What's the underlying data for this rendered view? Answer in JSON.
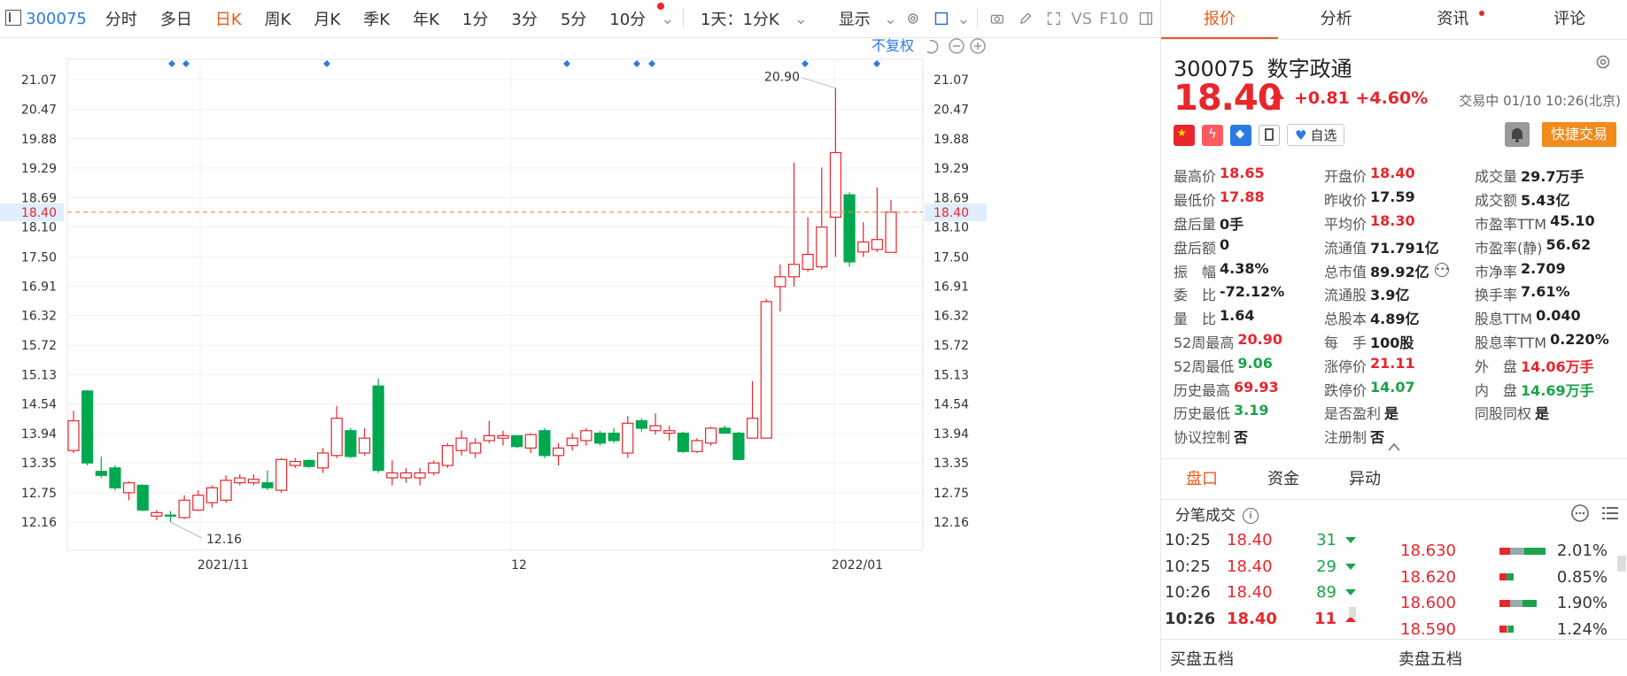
{
  "toolbar": {
    "code": "300075",
    "items": [
      "分时",
      "多日",
      "日K",
      "周K",
      "月K",
      "季K",
      "年K",
      "1分",
      "3分",
      "5分",
      "10分"
    ],
    "active": "日K",
    "timeframe": "1天：1分K",
    "display": "显示",
    "vs": "VS",
    "f10": "F10"
  },
  "chart_data": {
    "type": "candlestick",
    "y_ticks": [
      "21.07",
      "20.47",
      "19.88",
      "19.29",
      "18.69",
      "18.10",
      "17.50",
      "16.91",
      "16.32",
      "15.72",
      "15.13",
      "14.54",
      "13.94",
      "13.35",
      "12.75",
      "12.16"
    ],
    "current_price_label": "18.40",
    "current_price": 18.4,
    "x_labels": [
      "2021/11",
      "12",
      "2022/01"
    ],
    "max_label": "20.90",
    "min_label": "12.16",
    "adjust_label": "不复权",
    "up_color": "#e8262c",
    "down_color": "#00a84f",
    "candles": [
      {
        "o": 13.6,
        "h": 14.4,
        "l": 13.55,
        "c": 14.2
      },
      {
        "o": 14.8,
        "h": 14.82,
        "l": 13.3,
        "c": 13.35
      },
      {
        "o": 13.18,
        "h": 13.48,
        "l": 13.05,
        "c": 13.1
      },
      {
        "o": 13.25,
        "h": 13.3,
        "l": 12.8,
        "c": 12.85
      },
      {
        "o": 12.75,
        "h": 12.98,
        "l": 12.6,
        "c": 12.95
      },
      {
        "o": 12.9,
        "h": 12.92,
        "l": 12.38,
        "c": 12.4
      },
      {
        "o": 12.28,
        "h": 12.4,
        "l": 12.2,
        "c": 12.35
      },
      {
        "o": 12.3,
        "h": 12.38,
        "l": 12.16,
        "c": 12.28
      },
      {
        "o": 12.25,
        "h": 12.7,
        "l": 12.22,
        "c": 12.6
      },
      {
        "o": 12.4,
        "h": 12.8,
        "l": 12.38,
        "c": 12.7
      },
      {
        "o": 12.55,
        "h": 12.9,
        "l": 12.45,
        "c": 12.85
      },
      {
        "o": 12.6,
        "h": 13.1,
        "l": 12.55,
        "c": 13.0
      },
      {
        "o": 12.95,
        "h": 13.12,
        "l": 12.9,
        "c": 13.05
      },
      {
        "o": 12.95,
        "h": 13.12,
        "l": 12.9,
        "c": 13.02
      },
      {
        "o": 12.95,
        "h": 13.2,
        "l": 12.8,
        "c": 12.85
      },
      {
        "o": 12.8,
        "h": 13.45,
        "l": 12.75,
        "c": 13.42
      },
      {
        "o": 13.3,
        "h": 13.45,
        "l": 13.25,
        "c": 13.38
      },
      {
        "o": 13.4,
        "h": 13.42,
        "l": 13.25,
        "c": 13.28
      },
      {
        "o": 13.25,
        "h": 13.65,
        "l": 13.15,
        "c": 13.55
      },
      {
        "o": 13.5,
        "h": 14.5,
        "l": 13.45,
        "c": 14.25
      },
      {
        "o": 14.0,
        "h": 14.05,
        "l": 13.45,
        "c": 13.48
      },
      {
        "o": 13.55,
        "h": 14.05,
        "l": 13.5,
        "c": 13.85
      },
      {
        "o": 14.9,
        "h": 15.05,
        "l": 13.15,
        "c": 13.2
      },
      {
        "o": 13.05,
        "h": 13.4,
        "l": 12.9,
        "c": 13.15
      },
      {
        "o": 13.05,
        "h": 13.25,
        "l": 12.95,
        "c": 13.15
      },
      {
        "o": 13.05,
        "h": 13.25,
        "l": 12.9,
        "c": 13.15
      },
      {
        "o": 13.15,
        "h": 13.4,
        "l": 13.1,
        "c": 13.35
      },
      {
        "o": 13.3,
        "h": 13.75,
        "l": 13.25,
        "c": 13.7
      },
      {
        "o": 13.6,
        "h": 14.0,
        "l": 13.5,
        "c": 13.85
      },
      {
        "o": 13.55,
        "h": 13.85,
        "l": 13.45,
        "c": 13.75
      },
      {
        "o": 13.8,
        "h": 14.2,
        "l": 13.75,
        "c": 13.9
      },
      {
        "o": 13.85,
        "h": 14.0,
        "l": 13.7,
        "c": 13.9
      },
      {
        "o": 13.9,
        "h": 13.9,
        "l": 13.65,
        "c": 13.68
      },
      {
        "o": 13.65,
        "h": 13.95,
        "l": 13.55,
        "c": 13.92
      },
      {
        "o": 14.0,
        "h": 14.05,
        "l": 13.45,
        "c": 13.5
      },
      {
        "o": 13.5,
        "h": 13.75,
        "l": 13.3,
        "c": 13.65
      },
      {
        "o": 13.7,
        "h": 13.95,
        "l": 13.6,
        "c": 13.85
      },
      {
        "o": 13.8,
        "h": 14.05,
        "l": 13.7,
        "c": 14.0
      },
      {
        "o": 13.95,
        "h": 14.0,
        "l": 13.7,
        "c": 13.75
      },
      {
        "o": 13.95,
        "h": 14.05,
        "l": 13.75,
        "c": 13.8
      },
      {
        "o": 13.55,
        "h": 14.3,
        "l": 13.45,
        "c": 14.15
      },
      {
        "o": 14.2,
        "h": 14.25,
        "l": 13.98,
        "c": 14.05
      },
      {
        "o": 14.0,
        "h": 14.35,
        "l": 13.92,
        "c": 14.1
      },
      {
        "o": 13.95,
        "h": 14.1,
        "l": 13.8,
        "c": 14.0
      },
      {
        "o": 13.95,
        "h": 13.98,
        "l": 13.55,
        "c": 13.58
      },
      {
        "o": 13.58,
        "h": 13.85,
        "l": 13.55,
        "c": 13.8
      },
      {
        "o": 13.75,
        "h": 14.08,
        "l": 13.7,
        "c": 14.05
      },
      {
        "o": 14.05,
        "h": 14.1,
        "l": 13.95,
        "c": 13.95
      },
      {
        "o": 13.95,
        "h": 13.98,
        "l": 13.4,
        "c": 13.42
      },
      {
        "o": 13.85,
        "h": 15.0,
        "l": 13.85,
        "c": 14.25
      },
      {
        "o": 13.85,
        "h": 16.65,
        "l": 13.85,
        "c": 16.6
      },
      {
        "o": 16.9,
        "h": 17.35,
        "l": 16.4,
        "c": 17.1
      },
      {
        "o": 17.1,
        "h": 19.4,
        "l": 16.9,
        "c": 17.35
      },
      {
        "o": 17.25,
        "h": 18.3,
        "l": 17.2,
        "c": 17.55
      },
      {
        "o": 17.3,
        "h": 19.3,
        "l": 17.25,
        "c": 18.1
      },
      {
        "o": 18.3,
        "h": 20.9,
        "l": 17.5,
        "c": 19.6
      },
      {
        "o": 18.75,
        "h": 18.8,
        "l": 17.3,
        "c": 17.4
      },
      {
        "o": 17.6,
        "h": 18.2,
        "l": 17.5,
        "c": 17.8
      },
      {
        "o": 17.65,
        "h": 18.9,
        "l": 17.6,
        "c": 17.85
      },
      {
        "o": 17.59,
        "h": 18.65,
        "l": 17.88,
        "c": 18.4
      }
    ]
  },
  "tabs": [
    "报价",
    "分析",
    "资讯",
    "评论"
  ],
  "quote": {
    "code": "300075",
    "name": "数字政通",
    "price": "18.40",
    "change": "+0.81",
    "change_pct": "+4.60%",
    "status": "交易中 01/10 10:26(北京)",
    "watch": "自选",
    "quick_trade": "快捷交易"
  },
  "stats": [
    [
      {
        "l": "最高价",
        "v": "18.65",
        "c": "red"
      },
      {
        "l": "开盘价",
        "v": "18.40",
        "c": "red"
      },
      {
        "l": "成交量",
        "v": "29.7万手",
        "c": "blk"
      }
    ],
    [
      {
        "l": "最低价",
        "v": "17.88",
        "c": "red"
      },
      {
        "l": "昨收价",
        "v": "17.59",
        "c": "blk"
      },
      {
        "l": "成交额",
        "v": "5.43亿",
        "c": "blk"
      }
    ],
    [
      {
        "l": "盘后量",
        "v": "0手",
        "c": "blk"
      },
      {
        "l": "平均价",
        "v": "18.30",
        "c": "red"
      },
      {
        "l": "市盈率TTM",
        "v": "45.10",
        "c": "blk"
      }
    ],
    [
      {
        "l": "盘后额",
        "v": "0",
        "c": "blk"
      },
      {
        "l": "流通值",
        "v": "71.791亿",
        "c": "blk"
      },
      {
        "l": "市盈率(静)",
        "v": "56.62",
        "c": "blk"
      }
    ],
    [
      {
        "l": "振　幅",
        "v": "4.38%",
        "c": "blk"
      },
      {
        "l": "总市值",
        "v": "89.92亿",
        "c": "blk"
      },
      {
        "l": "市净率",
        "v": "2.709",
        "c": "blk"
      }
    ],
    [
      {
        "l": "委　比",
        "v": "-72.12%",
        "c": "blk"
      },
      {
        "l": "流通股",
        "v": "3.9亿",
        "c": "blk"
      },
      {
        "l": "换手率",
        "v": "7.61%",
        "c": "blk"
      }
    ],
    [
      {
        "l": "量　比",
        "v": "1.64",
        "c": "blk"
      },
      {
        "l": "总股本",
        "v": "4.89亿",
        "c": "blk"
      },
      {
        "l": "股息TTM",
        "v": "0.040",
        "c": "blk"
      }
    ],
    [
      {
        "l": "52周最高",
        "v": "20.90",
        "c": "red"
      },
      {
        "l": "每　手",
        "v": "100股",
        "c": "blk"
      },
      {
        "l": "股息率TTM",
        "v": "0.220%",
        "c": "blk"
      }
    ],
    [
      {
        "l": "52周最低",
        "v": "9.06",
        "c": "green"
      },
      {
        "l": "涨停价",
        "v": "21.11",
        "c": "red"
      },
      {
        "l": "外　盘",
        "v": "14.06万手",
        "c": "red"
      }
    ],
    [
      {
        "l": "历史最高",
        "v": "69.93",
        "c": "red"
      },
      {
        "l": "跌停价",
        "v": "14.07",
        "c": "green"
      },
      {
        "l": "内　盘",
        "v": "14.69万手",
        "c": "green"
      }
    ],
    [
      {
        "l": "历史最低",
        "v": "3.19",
        "c": "green"
      },
      {
        "l": "是否盈利",
        "v": "是",
        "c": "blk"
      },
      {
        "l": "同股同权",
        "v": "是",
        "c": "blk"
      }
    ],
    [
      {
        "l": "协议控制",
        "v": "否",
        "c": "blk"
      },
      {
        "l": "注册制",
        "v": "否",
        "c": "blk"
      },
      {
        "l": "",
        "v": "",
        "c": "blk"
      }
    ]
  ],
  "subtabs": [
    "盘口",
    "资金",
    "异动"
  ],
  "fenbi_title": "分笔成交",
  "ticks": [
    {
      "t": "10:25",
      "p": "18.40",
      "v": "31",
      "d": "dn"
    },
    {
      "t": "10:25",
      "p": "18.40",
      "v": "29",
      "d": "dn"
    },
    {
      "t": "10:26",
      "p": "18.40",
      "v": "89",
      "d": "dn"
    },
    {
      "t": "10:26",
      "p": "18.40",
      "v": "11",
      "d": "up"
    }
  ],
  "levels": [
    {
      "p": "18.630",
      "pct": "2.01%"
    },
    {
      "p": "18.620",
      "pct": "0.85%"
    },
    {
      "p": "18.600",
      "pct": "1.90%"
    },
    {
      "p": "18.590",
      "pct": "1.24%"
    }
  ],
  "bottom": {
    "buy": "买盘五档",
    "sell": "卖盘五档"
  }
}
